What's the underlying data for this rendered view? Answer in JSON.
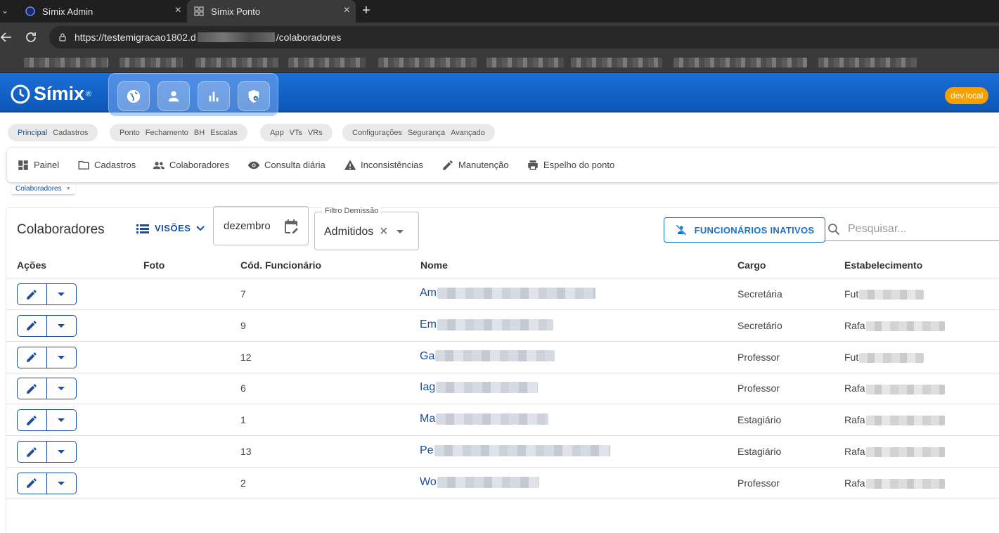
{
  "browser": {
    "tabs": [
      {
        "title": "Símix Admin",
        "active": false
      },
      {
        "title": "Símix Ponto",
        "active": true
      }
    ],
    "url_prefix": "https://testemigracao1802.d",
    "url_suffix": "/colaboradores",
    "new_tab_glyph": "+",
    "close_glyph": "×"
  },
  "app": {
    "brand": "Símix",
    "brand_mark": "®",
    "modules": [
      "globe-icon",
      "person-icon",
      "bar-chart-icon",
      "shield-lock-icon"
    ],
    "env_badge": "dev.local",
    "accent": "#1a4fa0",
    "header_color": "#1565c0",
    "badge_color": "#f5a000"
  },
  "groups": [
    {
      "items": [
        "Principal",
        "Cadastros"
      ],
      "active": "Principal"
    },
    {
      "items": [
        "Ponto",
        "Fechamento",
        "BH",
        "Escalas"
      ]
    },
    {
      "items": [
        "App",
        "VTs",
        "VRs"
      ]
    },
    {
      "items": [
        "Configurações",
        "Segurança",
        "Avançado"
      ]
    }
  ],
  "menu": [
    {
      "label": "Painel",
      "icon": "dashboard-icon"
    },
    {
      "label": "Cadastros",
      "icon": "folder-icon"
    },
    {
      "label": "Colaboradores",
      "icon": "people-icon"
    },
    {
      "label": "Consulta diária",
      "icon": "eye-icon"
    },
    {
      "label": "Inconsistências",
      "icon": "warning-icon"
    },
    {
      "label": "Manutenção",
      "icon": "pencil-icon"
    },
    {
      "label": "Espelho do ponto",
      "icon": "printer-icon"
    }
  ],
  "breadcrumb": "Colaboradores",
  "page": {
    "title": "Colaboradores",
    "visoes_label": "VISÕES",
    "month": "dezembro",
    "filter_label": "Filtro Demissão",
    "filter_value": "Admitidos",
    "inactive_button": "FUNCIONÁRIOS INATIVOS",
    "search_placeholder": "Pesquisar..."
  },
  "table": {
    "headers": [
      "Ações",
      "Foto",
      "Cód. Funcionário",
      "Nome",
      "Cargo",
      "Estabelecimento"
    ],
    "rows": [
      {
        "code": "7",
        "name": "Am",
        "cargo": "Secretária",
        "estab": "Fut"
      },
      {
        "code": "9",
        "name": "Em",
        "cargo": "Secretário",
        "estab": "Rafa"
      },
      {
        "code": "12",
        "name": "Ga",
        "cargo": "Professor",
        "estab": "Fut"
      },
      {
        "code": "6",
        "name": "Iag",
        "cargo": "Professor",
        "estab": "Rafa"
      },
      {
        "code": "1",
        "name": "Ma",
        "cargo": "Estagiário",
        "estab": "Rafa"
      },
      {
        "code": "13",
        "name": "Pe",
        "cargo": "Estagiário",
        "estab": "Rafa"
      },
      {
        "code": "2",
        "name": "Wo",
        "cargo": "Professor",
        "estab": "Rafa"
      }
    ]
  }
}
